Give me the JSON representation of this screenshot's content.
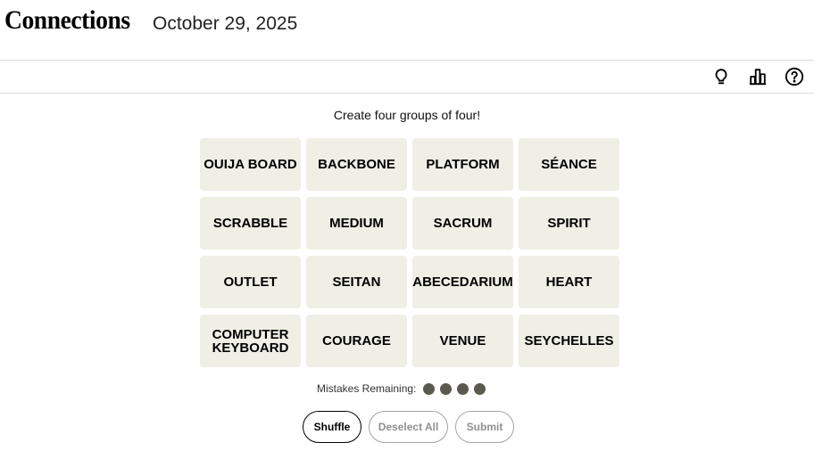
{
  "header": {
    "title": "Connections",
    "date": "October 29, 2025"
  },
  "toolbar": {
    "icons": [
      "lightbulb-icon",
      "leaderboard-icon",
      "help-icon"
    ]
  },
  "game": {
    "instructions": "Create four groups of four!",
    "tiles": [
      "OUIJA BOARD",
      "BACKBONE",
      "PLATFORM",
      "SÉANCE",
      "SCRABBLE",
      "MEDIUM",
      "SACRUM",
      "SPIRIT",
      "OUTLET",
      "SEITAN",
      "ABECEDARIUM",
      "HEART",
      "COMPUTER KEYBOARD",
      "COURAGE",
      "VENUE",
      "SEYCHELLES"
    ],
    "mistakes_label": "Mistakes Remaining:",
    "mistakes_remaining": 4
  },
  "buttons": {
    "shuffle": "Shuffle",
    "deselect_all": "Deselect All",
    "submit": "Submit"
  },
  "colors": {
    "tile_bg": "#efefe6",
    "dot": "#5a594e"
  }
}
